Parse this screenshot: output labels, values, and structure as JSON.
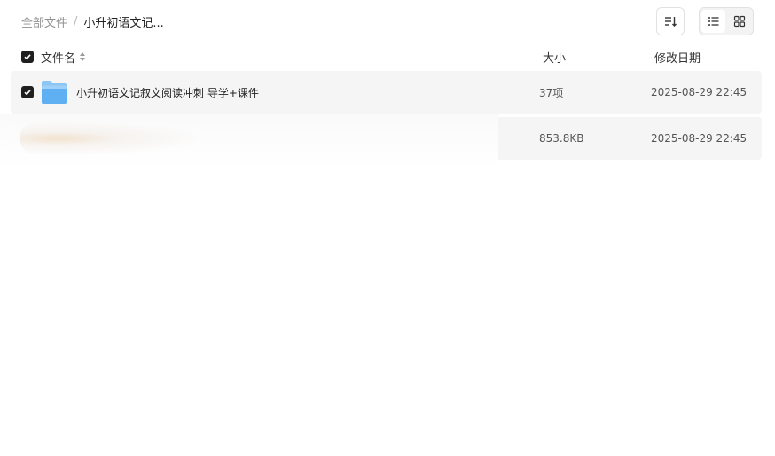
{
  "breadcrumb": {
    "root": "全部文件",
    "separator": "/",
    "current": "小升初语文记..."
  },
  "toolbar": {
    "sort_icon": "sort-icon",
    "list_view_icon": "list-view-icon",
    "grid_view_icon": "grid-view-icon",
    "active_view": "list"
  },
  "table": {
    "headers": {
      "name": "文件名",
      "size": "大小",
      "date": "修改日期"
    },
    "rows": [
      {
        "name": "小升初语文记叙文阅读冲刺 导学+课件",
        "size": "37项",
        "date": "2025-08-29 22:45",
        "icon": "folder-icon",
        "checked": true
      },
      {
        "name": "",
        "size": "853.8KB",
        "date": "2025-08-29 22:45",
        "icon": "file-icon",
        "checked": false
      }
    ]
  },
  "colors": {
    "row_bg": "#f5f5f5",
    "checkbox": "#1f1f1f",
    "folder": "#5fb0f2"
  }
}
